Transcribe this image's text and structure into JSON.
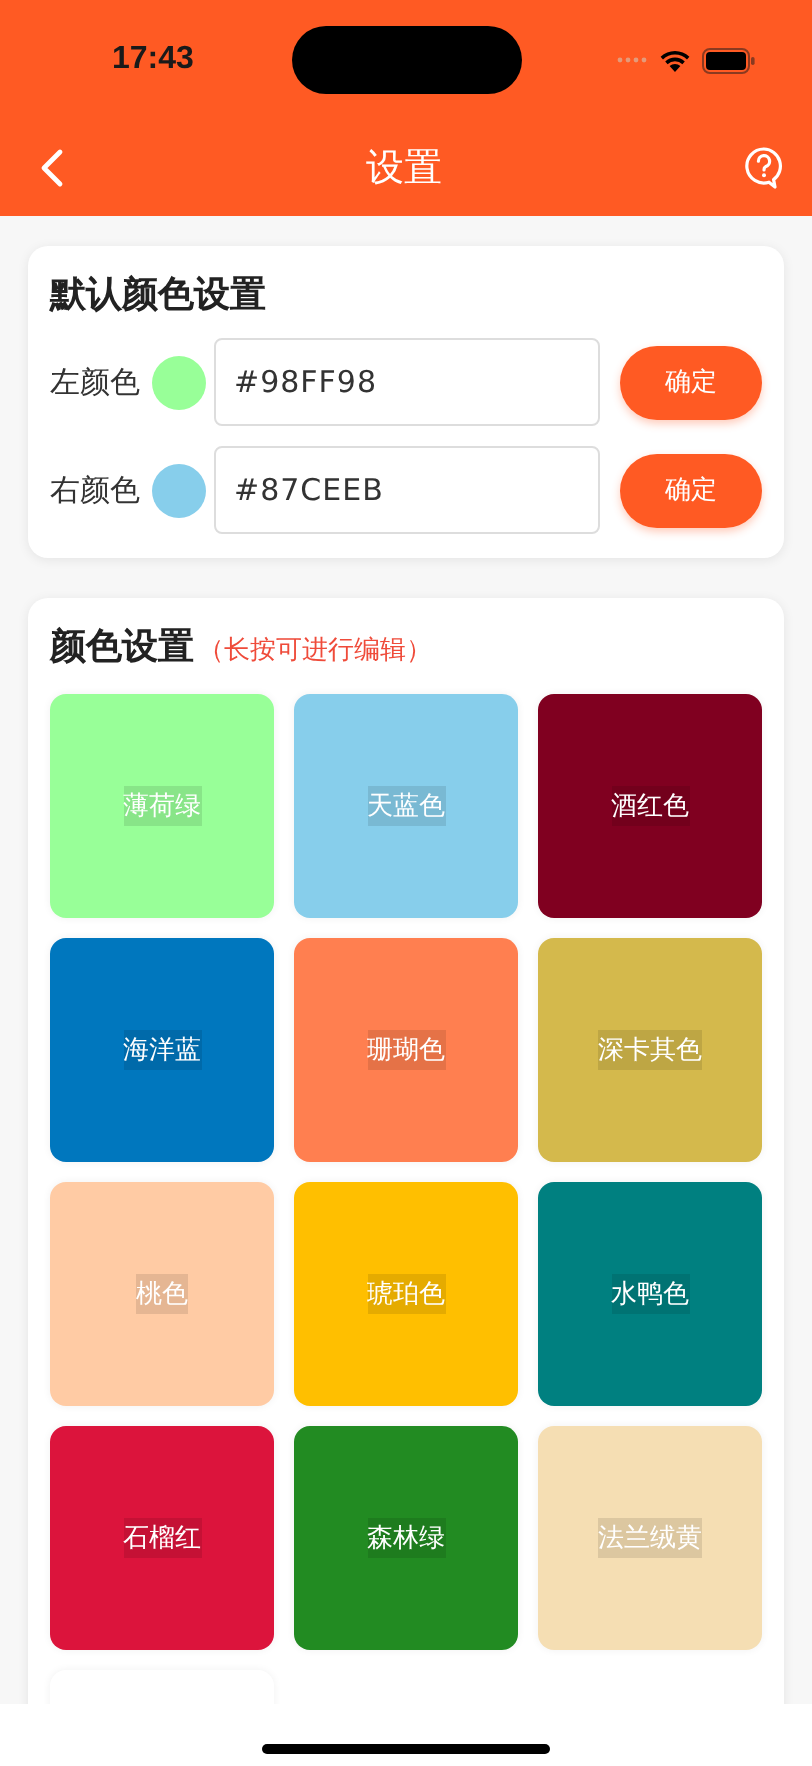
{
  "status_bar": {
    "time": "17:43"
  },
  "header": {
    "title": "设置"
  },
  "default_colors": {
    "title": "默认颜色设置",
    "rows": [
      {
        "label": "左颜色",
        "color": "#98ff98",
        "value": "#98FF98",
        "button": "确定"
      },
      {
        "label": "右颜色",
        "color": "#87ceeb",
        "value": "#87CEEB",
        "button": "确定"
      }
    ]
  },
  "color_settings": {
    "title": "颜色设置",
    "hint": "（长按可进行编辑）",
    "tiles": [
      {
        "label": "薄荷绿",
        "color": "#98ff98"
      },
      {
        "label": "天蓝色",
        "color": "#87ceeb"
      },
      {
        "label": "酒红色",
        "color": "#800020"
      },
      {
        "label": "海洋蓝",
        "color": "#0077be"
      },
      {
        "label": "珊瑚色",
        "color": "#ff7f50"
      },
      {
        "label": "深卡其色",
        "color": "#d4b94c"
      },
      {
        "label": "桃色",
        "color": "#ffcba4"
      },
      {
        "label": "琥珀色",
        "color": "#ffbf00"
      },
      {
        "label": "水鸭色",
        "color": "#008080"
      },
      {
        "label": "石榴红",
        "color": "#dc143c"
      },
      {
        "label": "森林绿",
        "color": "#228b22"
      },
      {
        "label": "法兰绒黄",
        "color": "#f5deb3"
      },
      {
        "color": "#ffffff"
      }
    ]
  }
}
